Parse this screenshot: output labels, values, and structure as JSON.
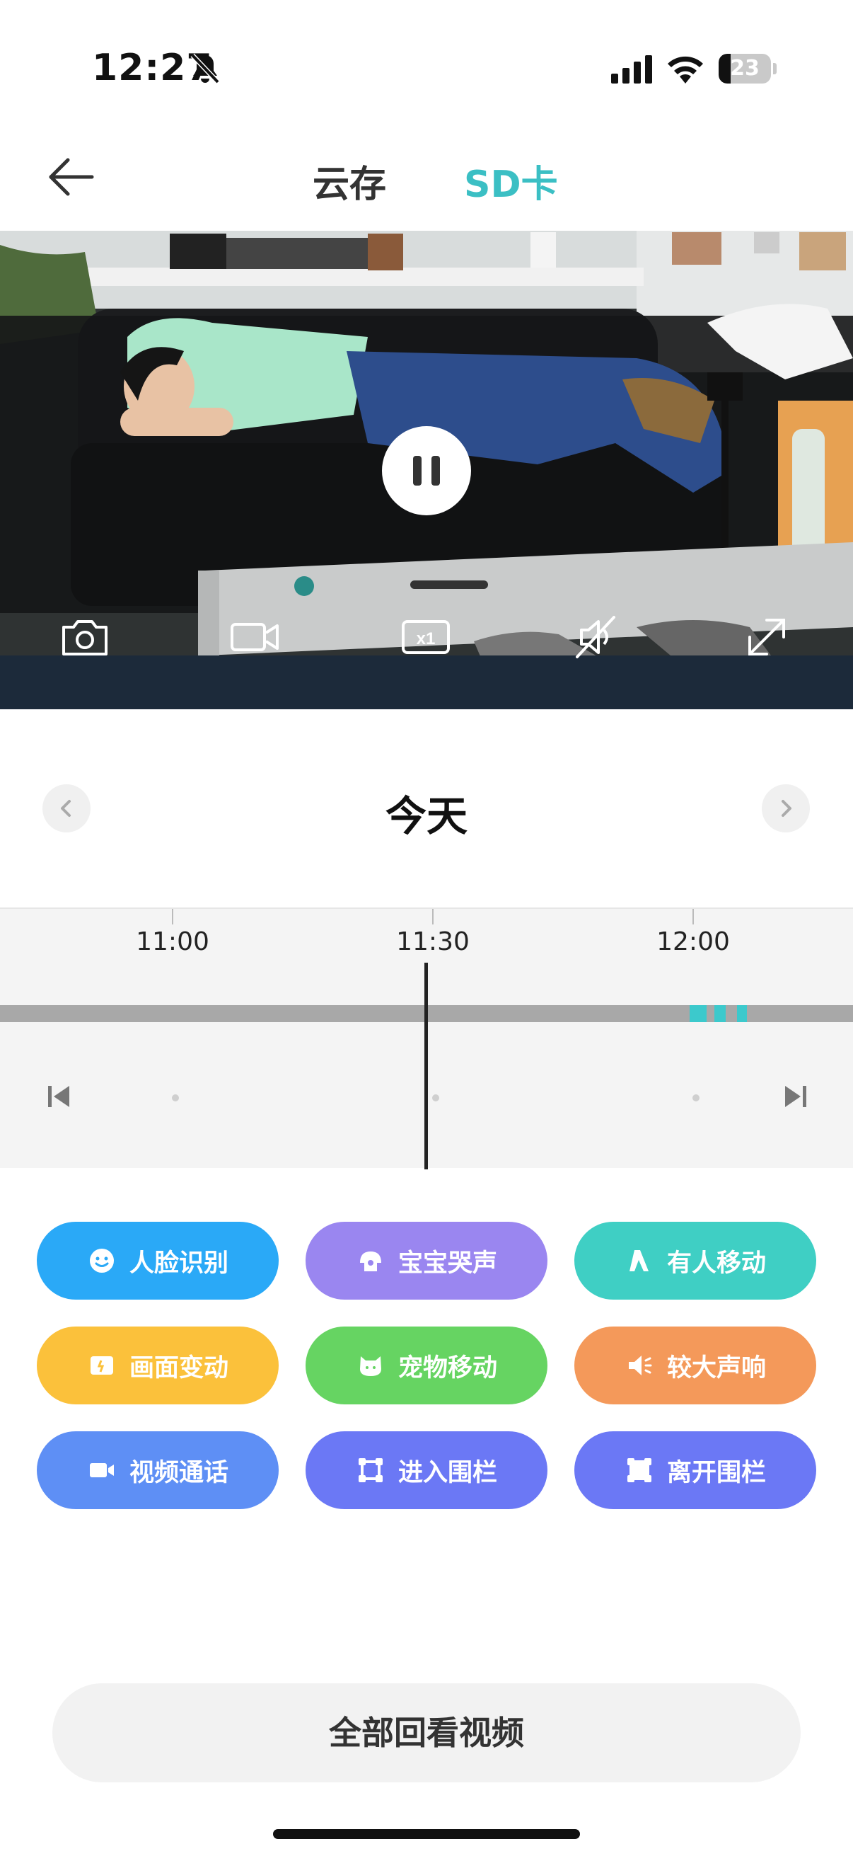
{
  "status_bar": {
    "time": "12:27",
    "battery": "23",
    "battery_level": 0.23
  },
  "header": {
    "tabs": [
      {
        "label": "云存",
        "active": false
      },
      {
        "label": "SD卡",
        "active": true
      }
    ]
  },
  "player": {
    "state": "playing",
    "controls": [
      "camera-icon",
      "record-icon",
      "speed-x1-icon",
      "mute-icon",
      "fullscreen-icon"
    ],
    "speed_label": "x1"
  },
  "date_nav": {
    "title": "今天"
  },
  "timeline": {
    "labels": [
      "11:00",
      "11:30",
      "12:00"
    ],
    "cursor_time": "11:30",
    "recorded_color": "#3cc9cc",
    "track_color": "#a8a8a8"
  },
  "filters": [
    {
      "label": "人脸识别",
      "icon": "face-icon",
      "color": "#2aa9f7"
    },
    {
      "label": "宝宝哭声",
      "icon": "baby-icon",
      "color": "#9a86f0"
    },
    {
      "label": "有人移动",
      "icon": "person-walk-icon",
      "color": "#3fcfc4"
    },
    {
      "label": "画面变动",
      "icon": "picture-change-icon",
      "color": "#fbc13b"
    },
    {
      "label": "宠物移动",
      "icon": "pet-icon",
      "color": "#66d462"
    },
    {
      "label": "较大声响",
      "icon": "speaker-icon",
      "color": "#f4995a"
    },
    {
      "label": "视频通话",
      "icon": "video-call-icon",
      "color": "#5e8ff5"
    },
    {
      "label": "进入围栏",
      "icon": "fence-enter-icon",
      "color": "#6b78f5"
    },
    {
      "label": "离开围栏",
      "icon": "fence-exit-icon",
      "color": "#6b78f5"
    }
  ],
  "bottom_button": {
    "label": "全部回看视频"
  }
}
